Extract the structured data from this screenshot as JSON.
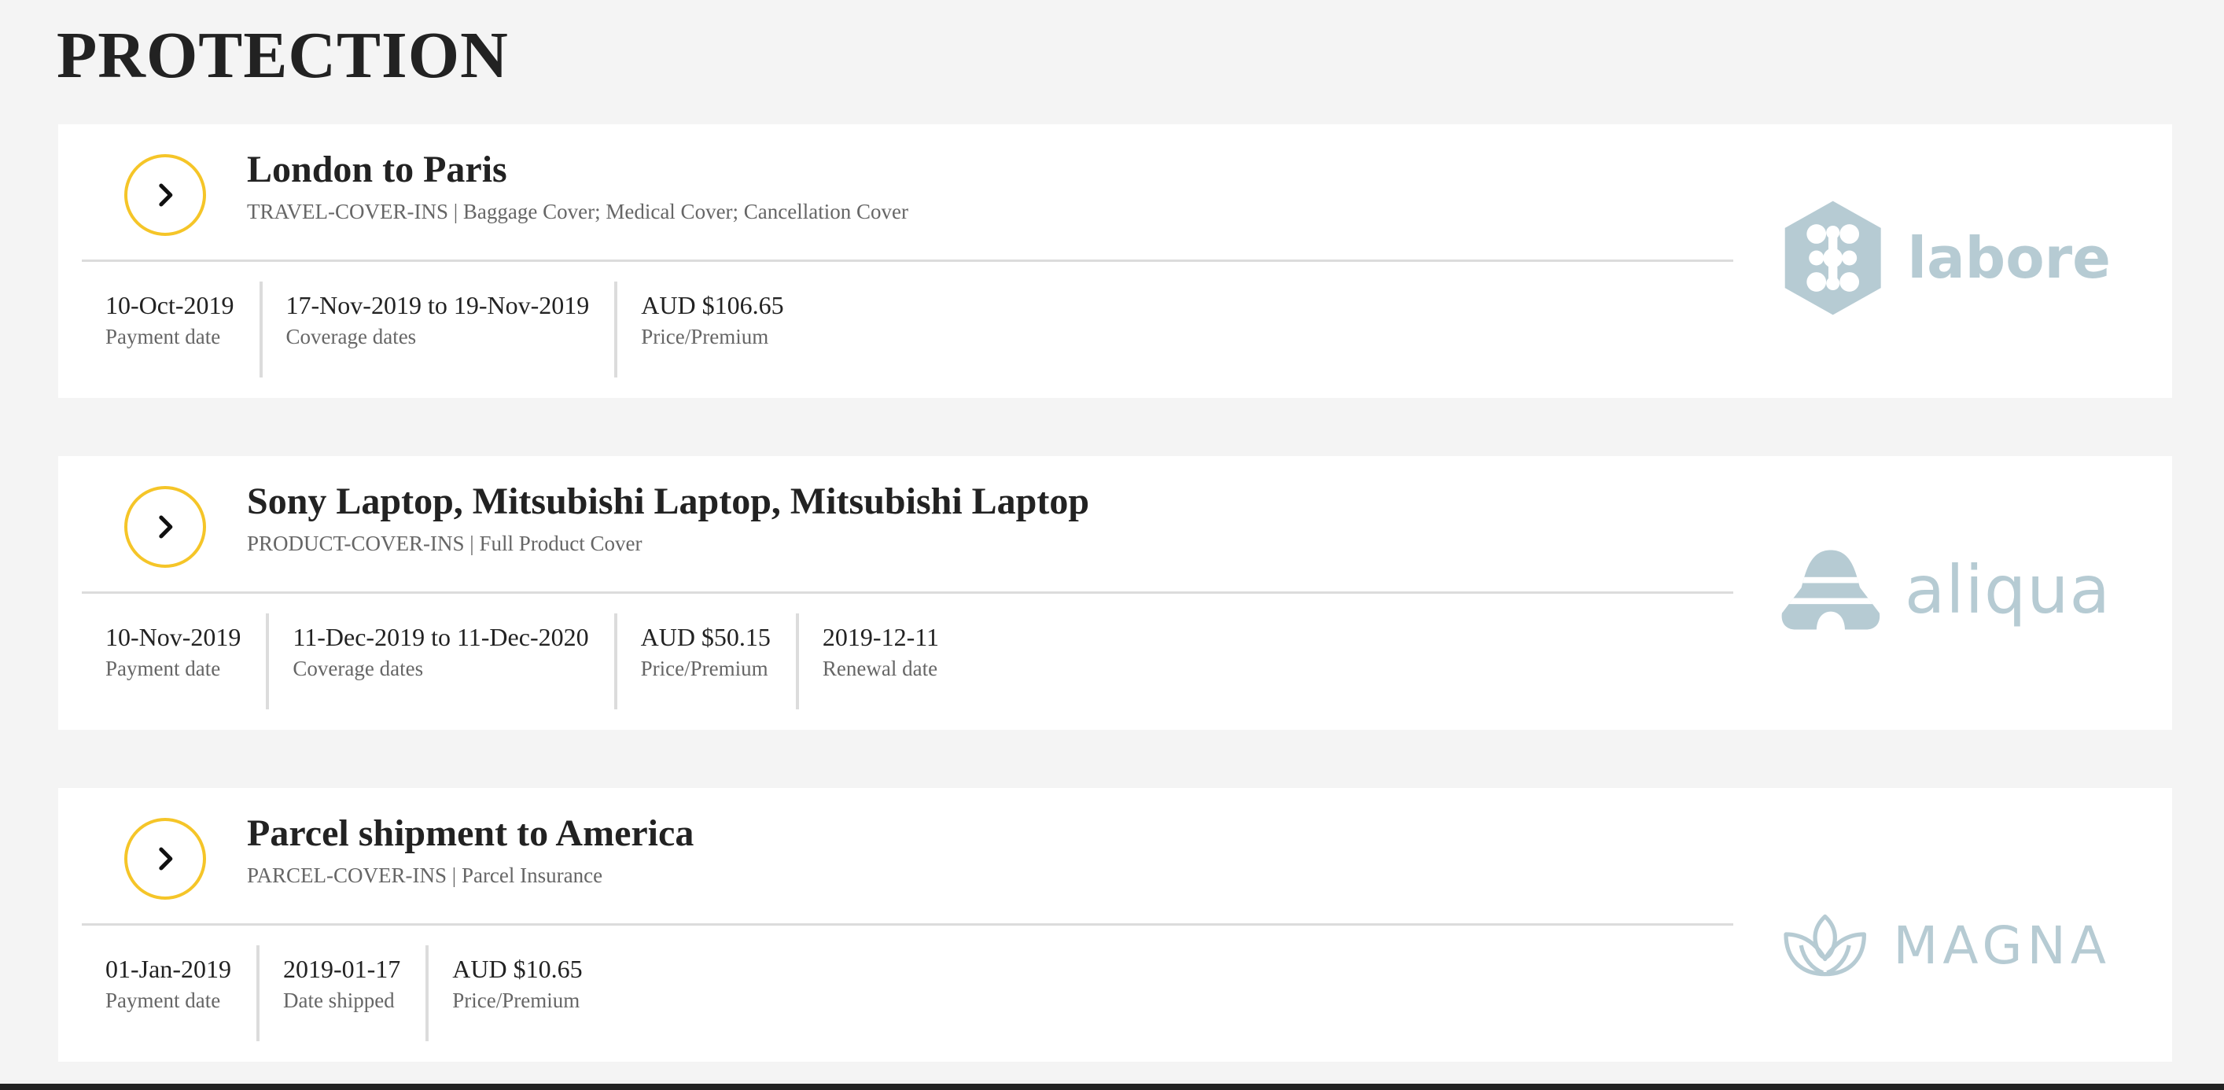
{
  "page": {
    "title": "PROTECTION"
  },
  "colors": {
    "accent": "#f5c528",
    "logo": "#b6cbd3",
    "background": "#f4f4f4"
  },
  "cards": [
    {
      "title": "London to Paris",
      "subtitle": "TRAVEL-COVER-INS | Baggage Cover; Medical Cover; Cancellation Cover",
      "arrow_icon": "chevron-right-icon",
      "logo": {
        "name": "labore",
        "icon": "hexagon-cells-logo-icon"
      },
      "details": [
        {
          "value": "10-Oct-2019",
          "label": "Payment date"
        },
        {
          "value": "17-Nov-2019 to 19-Nov-2019",
          "label": "Coverage dates"
        },
        {
          "value": "AUD $106.65",
          "label": "Price/Premium"
        }
      ]
    },
    {
      "title": "Sony Laptop, Mitsubishi Laptop, Mitsubishi Laptop",
      "subtitle": "PRODUCT-COVER-INS | Full Product Cover",
      "arrow_icon": "chevron-right-icon",
      "logo": {
        "name": "aliqua",
        "icon": "striped-dome-logo-icon"
      },
      "details": [
        {
          "value": "10-Nov-2019",
          "label": "Payment date"
        },
        {
          "value": "11-Dec-2019 to 11-Dec-2020",
          "label": "Coverage dates"
        },
        {
          "value": "AUD $50.15",
          "label": "Price/Premium"
        },
        {
          "value": "2019-12-11",
          "label": "Renewal date"
        }
      ]
    },
    {
      "title": "Parcel shipment to America",
      "subtitle": "PARCEL-COVER-INS | Parcel Insurance",
      "arrow_icon": "chevron-right-icon",
      "logo": {
        "name": "MAGNA",
        "icon": "lotus-logo-icon"
      },
      "details": [
        {
          "value": "01-Jan-2019",
          "label": "Payment date"
        },
        {
          "value": "2019-01-17",
          "label": "Date shipped"
        },
        {
          "value": "AUD $10.65",
          "label": "Price/Premium"
        }
      ]
    }
  ]
}
